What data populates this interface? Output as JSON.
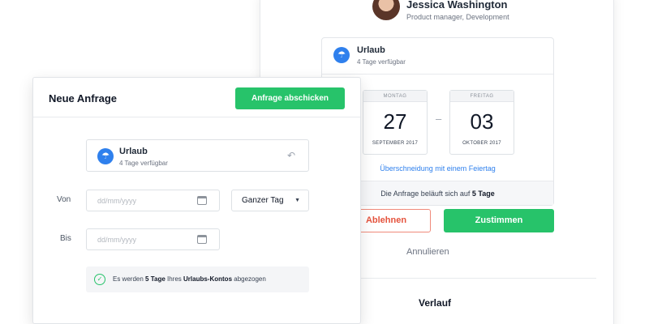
{
  "approver": {
    "name": "Jessica Washington",
    "role": "Product manager, Development"
  },
  "approval": {
    "leave_type": "Urlaub",
    "available": "4 Tage verfügbar",
    "start": {
      "weekday": "MONTAG",
      "day": "27",
      "month": "SEPTEMBER 2017"
    },
    "end": {
      "weekday": "FREITAG",
      "day": "03",
      "month": "OKTOBER 2017"
    },
    "separator": "–",
    "holiday_overlap": "Überschneidung mit einem Feiertag",
    "total_prefix": "Die Anfrage beläuft sich auf ",
    "total_value": "5 Tage",
    "reject_label": "Ablehnen",
    "approve_label": "Zustimmen",
    "cancel_label": "Annulieren",
    "history_title": "Verlauf"
  },
  "request": {
    "title": "Neue Anfrage",
    "submit_label": "Anfrage abschicken",
    "leave_type": "Urlaub",
    "available": "4 Tage verfügbar",
    "from_label": "Von",
    "to_label": "Bis",
    "date_placeholder": "dd/mm/yyyy",
    "day_option": "Ganzer Tag",
    "note_prefix": "Es werden ",
    "note_days": "5 Tage",
    "note_middle": " Ihres ",
    "note_account": "Urlaubs-Kontos",
    "note_suffix": " abgezogen"
  },
  "icons": {
    "leave_type": "umbrella-icon",
    "undo": "undo-icon",
    "calendar": "calendar-icon",
    "dropdown": "caret-down-icon",
    "check": "check-circle-icon"
  },
  "colors": {
    "primary_green": "#27c36a",
    "reject_red": "#e5533d",
    "link_blue": "#2f80ed"
  }
}
